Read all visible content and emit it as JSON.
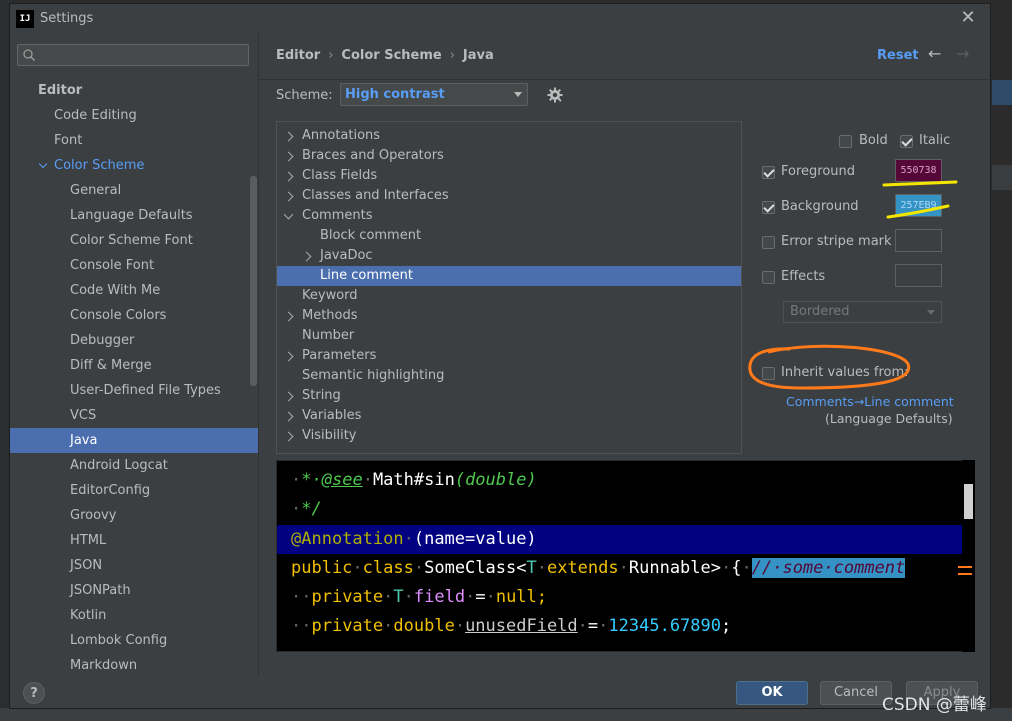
{
  "window": {
    "title": "Settings",
    "app_icon_text": "IJ"
  },
  "search": {
    "placeholder": ""
  },
  "sidebar": {
    "items": [
      {
        "label": "Editor",
        "level": 0
      },
      {
        "label": "Code Editing",
        "level": 1
      },
      {
        "label": "Font",
        "level": 1
      },
      {
        "label": "Color Scheme",
        "level": 1,
        "expanded": true,
        "highlight": true
      },
      {
        "label": "General",
        "level": 2
      },
      {
        "label": "Language Defaults",
        "level": 2
      },
      {
        "label": "Color Scheme Font",
        "level": 2
      },
      {
        "label": "Console Font",
        "level": 2
      },
      {
        "label": "Code With Me",
        "level": 2
      },
      {
        "label": "Console Colors",
        "level": 2
      },
      {
        "label": "Debugger",
        "level": 2
      },
      {
        "label": "Diff & Merge",
        "level": 2
      },
      {
        "label": "User-Defined File Types",
        "level": 2
      },
      {
        "label": "VCS",
        "level": 2
      },
      {
        "label": "Java",
        "level": 2,
        "selected": true
      },
      {
        "label": "Android Logcat",
        "level": 2
      },
      {
        "label": "EditorConfig",
        "level": 2
      },
      {
        "label": "Groovy",
        "level": 2
      },
      {
        "label": "HTML",
        "level": 2
      },
      {
        "label": "JSON",
        "level": 2
      },
      {
        "label": "JSONPath",
        "level": 2
      },
      {
        "label": "Kotlin",
        "level": 2
      },
      {
        "label": "Lombok Config",
        "level": 2
      },
      {
        "label": "Markdown",
        "level": 2
      }
    ]
  },
  "breadcrumb": [
    "Editor",
    "Color Scheme",
    "Java"
  ],
  "header": {
    "reset_label": "Reset"
  },
  "scheme": {
    "label": "Scheme:",
    "value": "High contrast"
  },
  "elements": [
    {
      "label": "Annotations",
      "indent": 0,
      "arrow": "right"
    },
    {
      "label": "Braces and Operators",
      "indent": 0,
      "arrow": "right"
    },
    {
      "label": "Class Fields",
      "indent": 0,
      "arrow": "right"
    },
    {
      "label": "Classes and Interfaces",
      "indent": 0,
      "arrow": "right"
    },
    {
      "label": "Comments",
      "indent": 0,
      "arrow": "down"
    },
    {
      "label": "Block comment",
      "indent": 1,
      "arrow": ""
    },
    {
      "label": "JavaDoc",
      "indent": 1,
      "arrow": "right"
    },
    {
      "label": "Line comment",
      "indent": 1,
      "arrow": "",
      "selected": true
    },
    {
      "label": "Keyword",
      "indent": 0,
      "arrow": ""
    },
    {
      "label": "Methods",
      "indent": 0,
      "arrow": "right"
    },
    {
      "label": "Number",
      "indent": 0,
      "arrow": ""
    },
    {
      "label": "Parameters",
      "indent": 0,
      "arrow": "right"
    },
    {
      "label": "Semantic highlighting",
      "indent": 0,
      "arrow": ""
    },
    {
      "label": "String",
      "indent": 0,
      "arrow": "right"
    },
    {
      "label": "Variables",
      "indent": 0,
      "arrow": "right"
    },
    {
      "label": "Visibility",
      "indent": 0,
      "arrow": "right"
    }
  ],
  "options": {
    "bold": {
      "label": "Bold",
      "checked": false
    },
    "italic": {
      "label": "Italic",
      "checked": true
    },
    "foreground": {
      "label": "Foreground",
      "checked": true,
      "value": "550738",
      "color": "#550738"
    },
    "background": {
      "label": "Background",
      "checked": true,
      "value": "257EB9",
      "color": "#3592c4"
    },
    "error_stripe": {
      "label": "Error stripe mark",
      "checked": false
    },
    "effects": {
      "label": "Effects",
      "checked": false,
      "type": "Bordered"
    },
    "inherit": {
      "label": "Inherit values from:",
      "checked": false,
      "link": "Comments→Line comment",
      "note": "(Language Defaults)"
    }
  },
  "preview": {
    "lines": [
      [
        {
          "t": "·",
          "c": "#666"
        },
        {
          "t": "*·",
          "c": "#4ec94e",
          "i": true
        },
        {
          "t": "@see",
          "c": "#4ec94e",
          "i": true,
          "u": true
        },
        {
          "t": "·",
          "c": "#666"
        },
        {
          "t": "Math#sin",
          "c": "#ffffff"
        },
        {
          "t": "(double)",
          "c": "#4ec94e",
          "i": true
        }
      ],
      [
        {
          "t": "·",
          "c": "#666"
        },
        {
          "t": "*/",
          "c": "#4ec94e",
          "i": true
        }
      ],
      [
        {
          "t": "@Annotation",
          "c": "#b0b000"
        },
        {
          "t": "·",
          "c": "#666"
        },
        {
          "t": "(name=value)",
          "c": "#ffffff"
        }
      ],
      [
        {
          "t": "public",
          "c": "#f0c000"
        },
        {
          "t": "·",
          "c": "#666"
        },
        {
          "t": "class",
          "c": "#f0c000"
        },
        {
          "t": "·",
          "c": "#666"
        },
        {
          "t": "SomeClass<",
          "c": "#ffffff"
        },
        {
          "t": "T",
          "c": "#4ec9b0"
        },
        {
          "t": "·",
          "c": "#666"
        },
        {
          "t": "extends",
          "c": "#f0c000"
        },
        {
          "t": "·",
          "c": "#666"
        },
        {
          "t": "Runnable>",
          "c": "#ffffff"
        },
        {
          "t": "·",
          "c": "#666"
        },
        {
          "t": "{",
          "c": "#ffffff"
        },
        {
          "t": "·",
          "c": "#666"
        },
        {
          "t": "//·some·comment",
          "c": "#550738",
          "bg": "#3592c4",
          "i": true
        }
      ],
      [
        {
          "t": "··",
          "c": "#666"
        },
        {
          "t": "private",
          "c": "#f0c000"
        },
        {
          "t": "·",
          "c": "#666"
        },
        {
          "t": "T",
          "c": "#4ec9b0"
        },
        {
          "t": "·",
          "c": "#666"
        },
        {
          "t": "field",
          "c": "#e08cff"
        },
        {
          "t": "·",
          "c": "#666"
        },
        {
          "t": "=",
          "c": "#ffffff"
        },
        {
          "t": "·",
          "c": "#666"
        },
        {
          "t": "null;",
          "c": "#f0c000"
        }
      ],
      [
        {
          "t": "··",
          "c": "#666"
        },
        {
          "t": "private",
          "c": "#f0c000"
        },
        {
          "t": "·",
          "c": "#666"
        },
        {
          "t": "double",
          "c": "#f0c000"
        },
        {
          "t": "·",
          "c": "#666"
        },
        {
          "t": "unusedField",
          "c": "#cccccc",
          "u": true
        },
        {
          "t": "·",
          "c": "#666"
        },
        {
          "t": "=",
          "c": "#ffffff"
        },
        {
          "t": "·",
          "c": "#666"
        },
        {
          "t": "12345.67890",
          "c": "#33ccff"
        },
        {
          "t": ";",
          "c": "#ffffff"
        }
      ]
    ]
  },
  "footer": {
    "help": "?",
    "ok": "OK",
    "cancel": "Cancel",
    "apply": "Apply"
  },
  "watermark": "CSDN @蕾峰",
  "colors": {
    "accent": "#589df6",
    "selection": "#4b6eaf",
    "annotation": "#ff7a1a",
    "highlighter": "#f5e600"
  }
}
